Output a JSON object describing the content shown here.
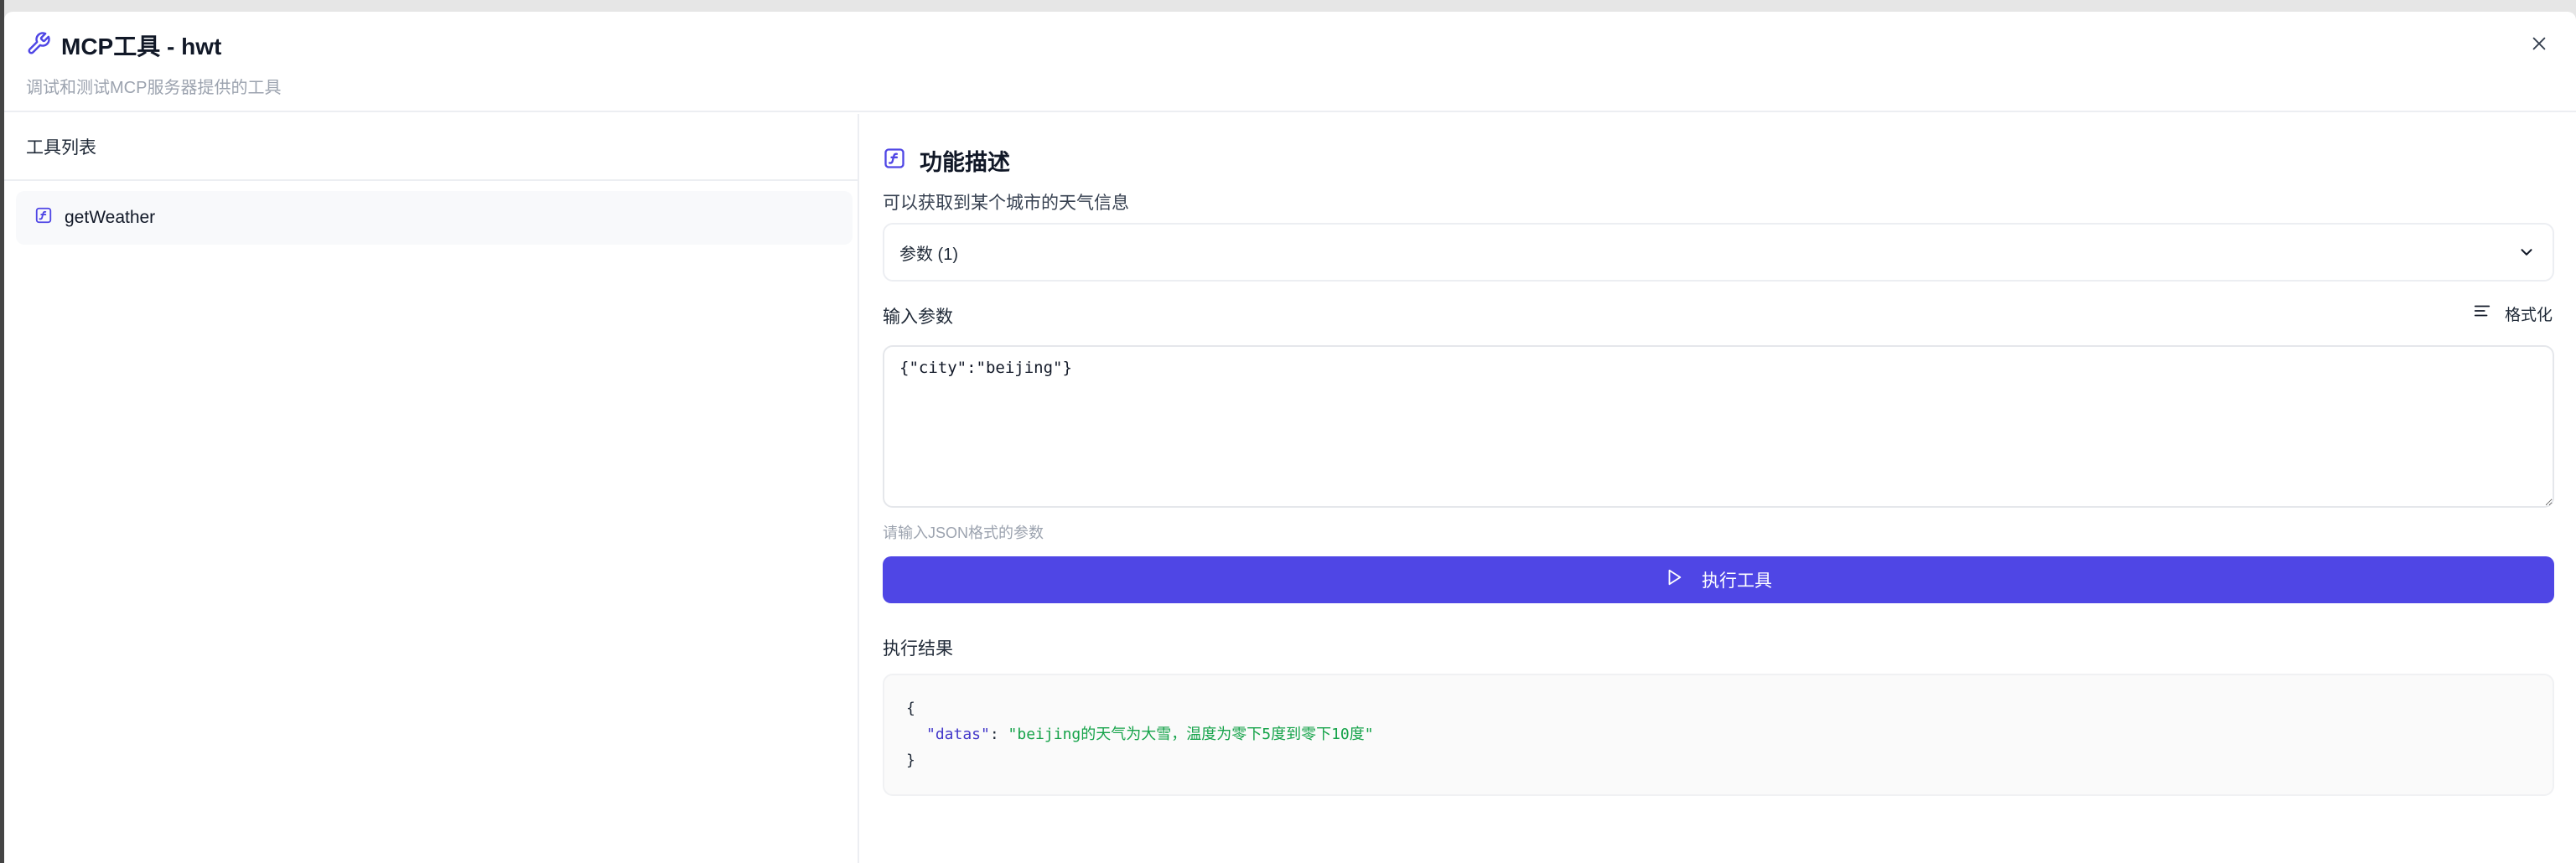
{
  "dialog": {
    "title": "MCP工具 - hwt",
    "subtitle": "调试和测试MCP服务器提供的工具"
  },
  "tool_list": {
    "title": "工具列表",
    "items": [
      {
        "name": "getWeather"
      }
    ]
  },
  "detail": {
    "section_title": "功能描述",
    "description": "可以获取到某个城市的天气信息",
    "params_label": "参数 (1)",
    "input_label": "输入参数",
    "format_label": "格式化",
    "input_value": "{\"city\":\"beijing\"}",
    "input_hint": "请输入JSON格式的参数",
    "execute_label": "执行工具",
    "result_label": "执行结果",
    "result": {
      "open": "{",
      "key": "\"datas\"",
      "colon": ": ",
      "value": "\"beijing的天气为大雪，温度为零下5度到零下10度\"",
      "close": "}"
    }
  },
  "colors": {
    "accent": "#4f46e5",
    "json_key": "#4338ca",
    "json_string": "#16a34a"
  },
  "icons": {
    "title": "wrench-icon",
    "close": "close-icon",
    "tool": "function-icon",
    "chevron": "chevron-down-icon",
    "format": "align-left-icon",
    "execute": "play-icon"
  }
}
